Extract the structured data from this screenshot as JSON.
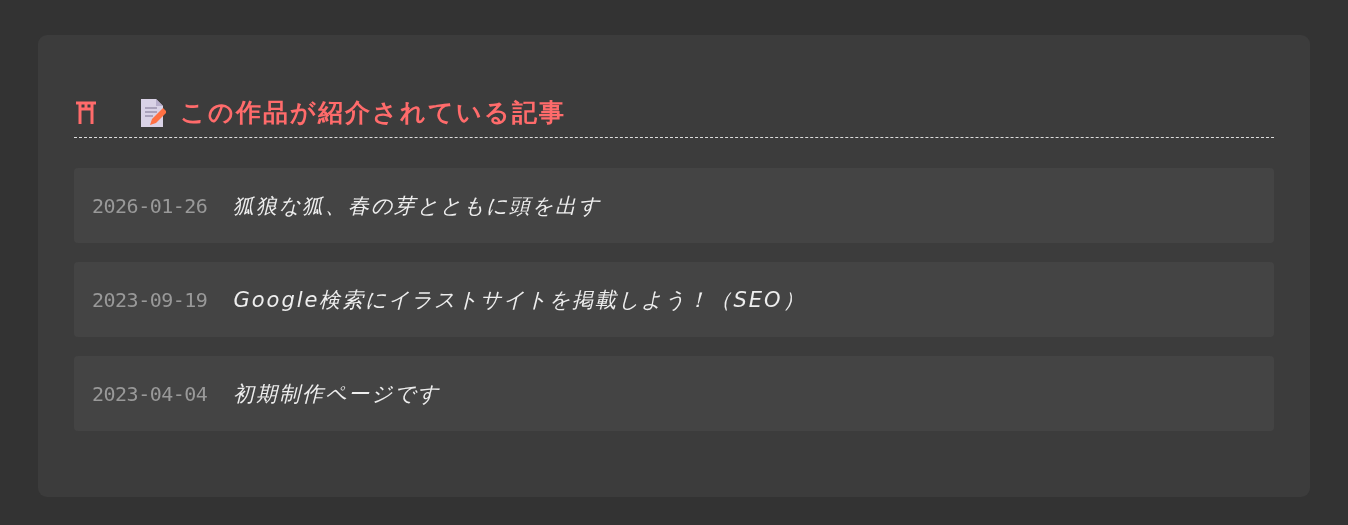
{
  "section": {
    "title": "この作品が紹介されている記事"
  },
  "articles": [
    {
      "date": "2026-01-26",
      "title": "狐狼な狐、春の芽とともに頭を出す"
    },
    {
      "date": "2023-09-19",
      "title": "Google検索にイラストサイトを掲載しよう！（SEO）"
    },
    {
      "date": "2023-04-04",
      "title": "初期制作ページです"
    }
  ]
}
